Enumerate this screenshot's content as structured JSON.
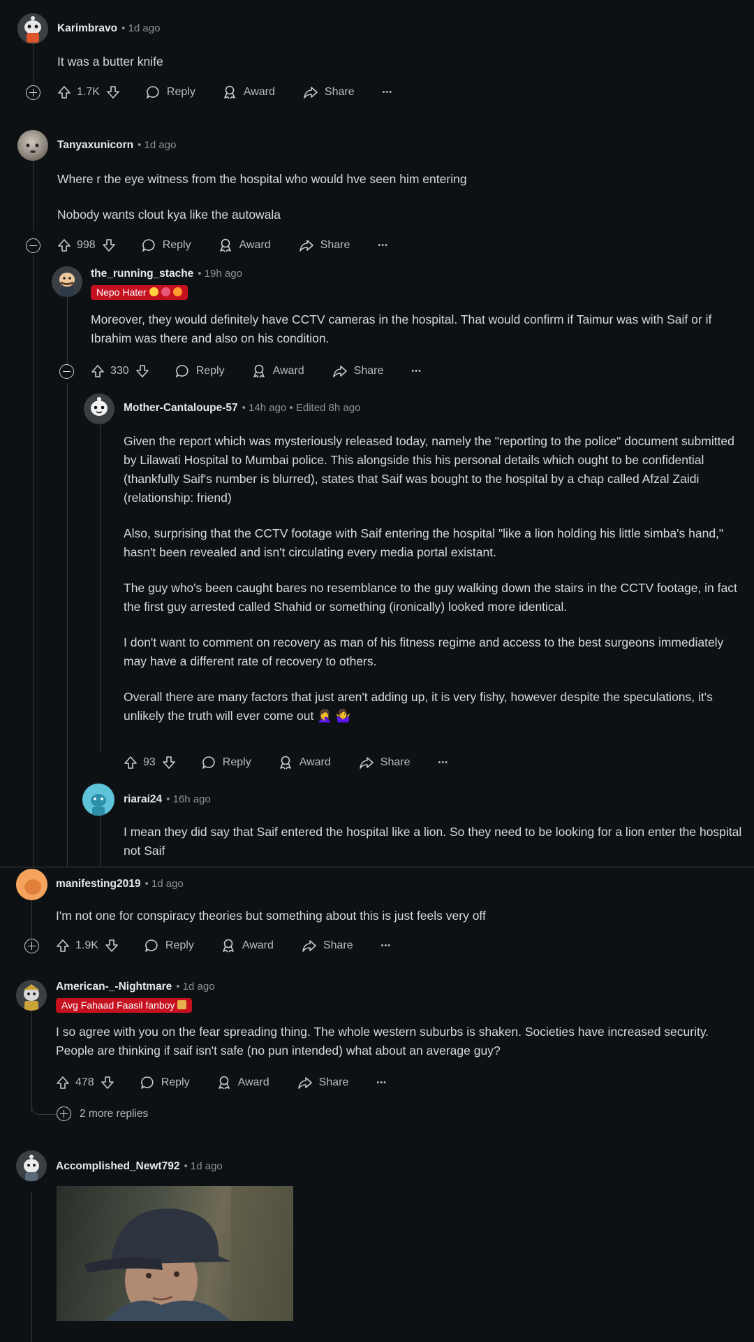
{
  "comments": {
    "c1": {
      "author": "Karimbravo",
      "meta": "• 1d ago",
      "lines": [
        "It was a butter knife"
      ],
      "votes": "1.7K"
    },
    "c2": {
      "author": "Tanyaxunicorn",
      "meta": "• 1d ago",
      "lines": [
        "Where r the eye witness from the hospital who would hve seen him entering",
        "Nobody wants clout kya like the autowala"
      ],
      "votes": "998"
    },
    "c3": {
      "author": "the_running_stache",
      "meta": "• 19h ago",
      "flair": "Nepo Hater",
      "lines": [
        "Moreover, they would definitely have CCTV cameras in the hospital. That would confirm if Taimur was with Saif or if Ibrahim was there and also on his condition."
      ],
      "votes": "330"
    },
    "c4": {
      "author": "Mother-Cantaloupe-57",
      "meta": "• 14h ago • Edited 8h ago",
      "lines": [
        "Given the report which was mysteriously released today, namely the \"reporting to the police\" document submitted by Lilawati Hospital to Mumbai police. This alongside this his personal details which ought to be confidential (thankfully Saif's number is blurred), states that Saif was bought to the hospital by a chap called Afzal Zaidi (relationship: friend)",
        "Also, surprising that the CCTV footage with Saif entering the hospital \"like a lion holding his little simba's hand,\" hasn't been revealed and isn't circulating every media portal existant.",
        "The guy who's been caught bares no resemblance to the guy walking down the stairs in the CCTV footage, in fact the first guy arrested called Shahid or something (ironically) looked more identical.",
        "I don't want to comment on recovery as man of his fitness regime and access to the best surgeons immediately may have a different rate of recovery to others.",
        "Overall there are many factors that just aren't adding up, it is very fishy, however despite the speculations, it's unlikely the truth will ever come out 🤦‍♀️ 🤷‍♀️"
      ],
      "votes": "93"
    },
    "c5": {
      "author": "riarai24",
      "meta": "• 16h ago",
      "lines": [
        "I mean they did say that Saif entered the hospital like a lion. So they need to be looking for a lion enter the hospital not Saif"
      ]
    },
    "c6": {
      "author": "manifesting2019",
      "meta": "• 1d ago",
      "lines": [
        "I'm not one for conspiracy theories but something about this is just feels very off"
      ],
      "votes": "1.9K"
    },
    "c7": {
      "author": "American-_-Nightmare",
      "meta": "• 1d ago",
      "flair": "Avg Fahaad Faasil fanboy",
      "lines": [
        "I so agree with you on the fear spreading thing. The whole western suburbs is shaken. Societies have increased security. People are thinking if saif isn't safe (no pun intended) what about an average guy?"
      ],
      "votes": "478",
      "more_replies": "2 more replies"
    },
    "c8": {
      "author": "Accomplished_Newt792",
      "meta": "• 1d ago"
    }
  },
  "labels": {
    "reply": "Reply",
    "award": "Award",
    "share": "Share",
    "more": "•••"
  },
  "colors": {
    "background": "#0e1113",
    "flair": "#c4101f",
    "text": "#d7dadc",
    "meta": "#8b9196"
  }
}
